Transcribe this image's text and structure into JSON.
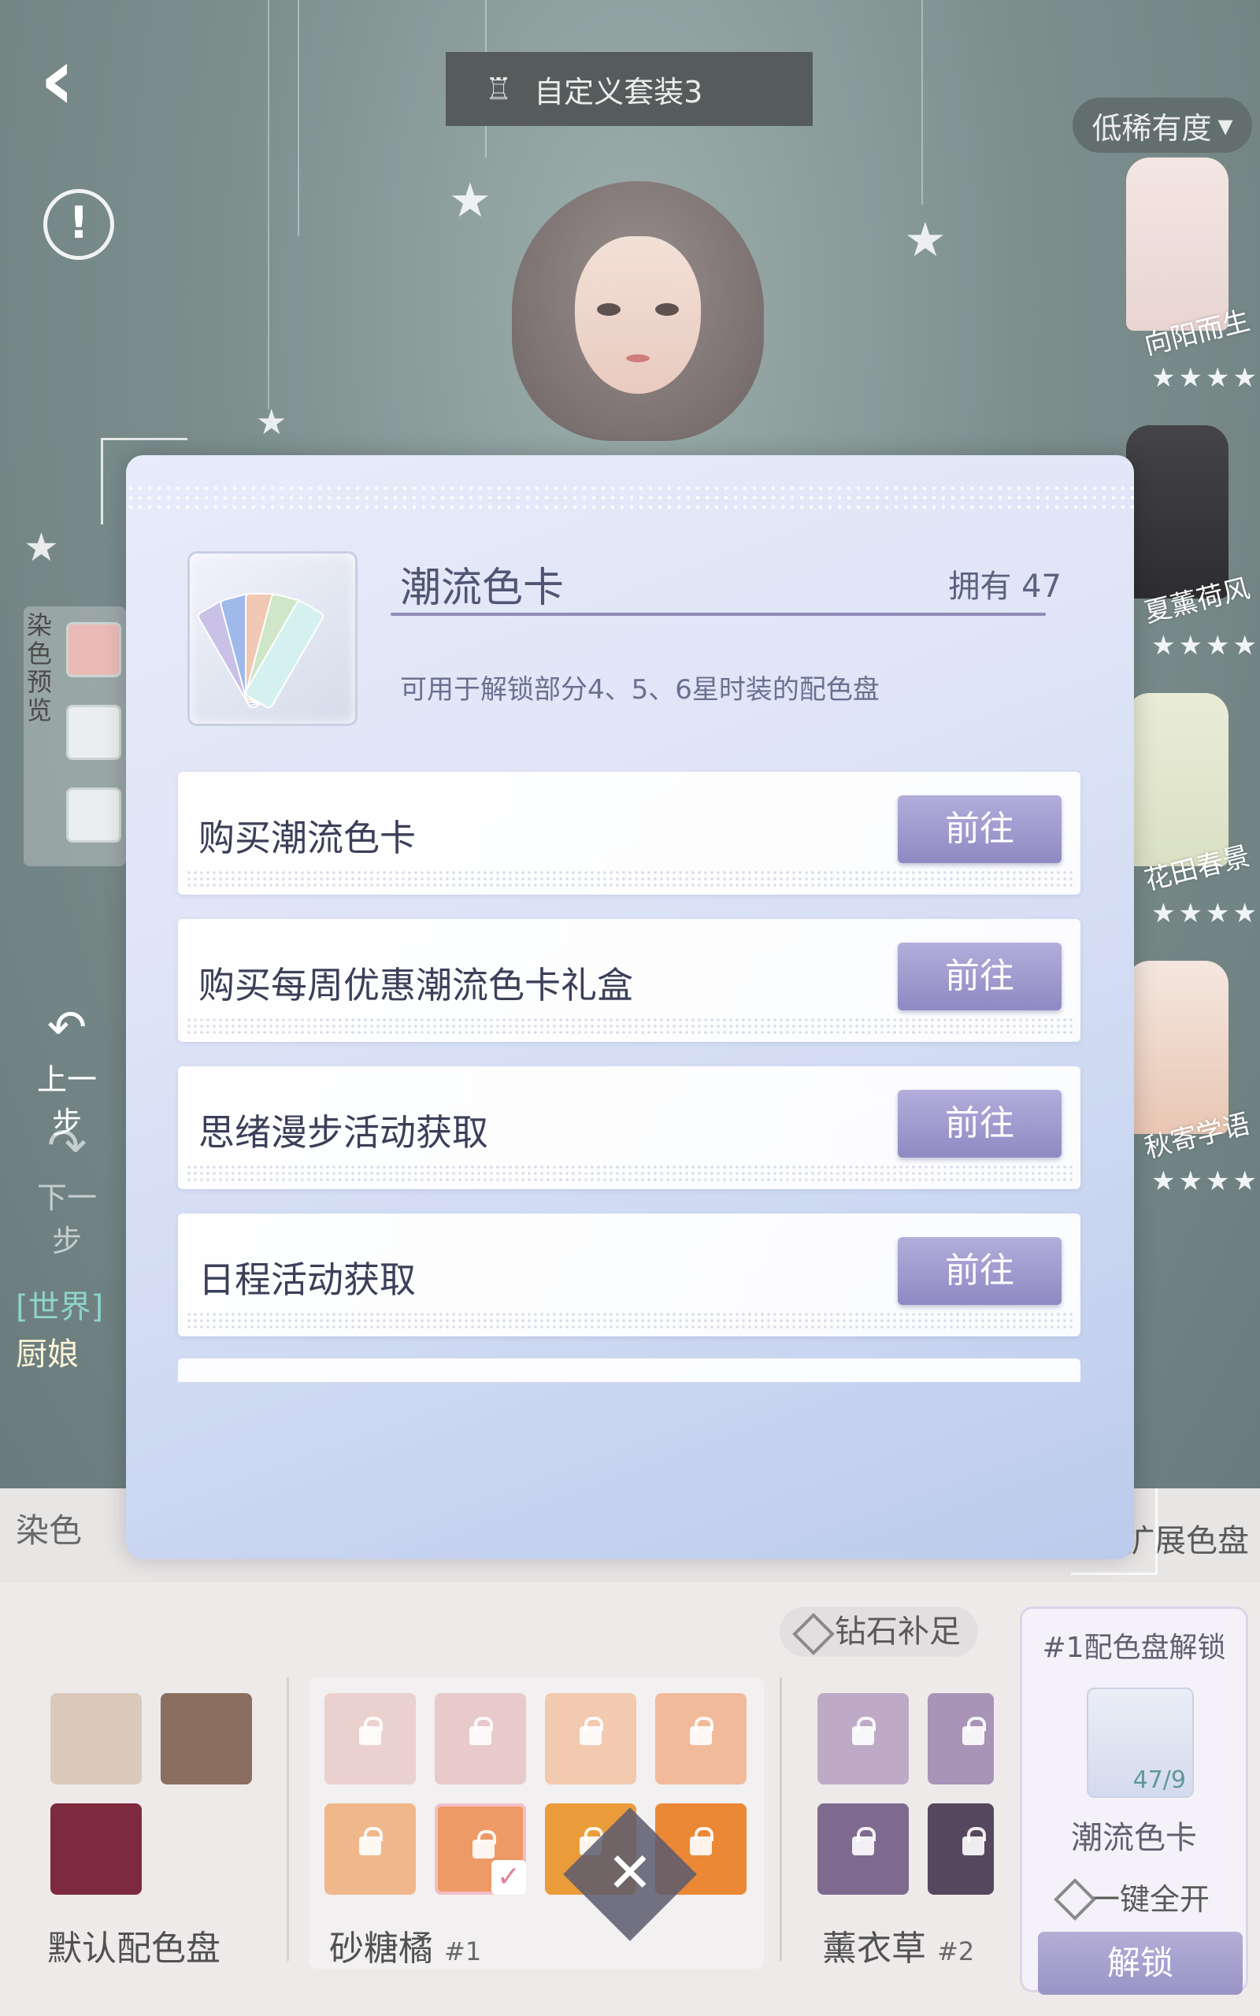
{
  "header": {
    "outfit_name": "自定义套装3",
    "sort_label": "低稀有度"
  },
  "outfits": [
    {
      "name": "向阳而生",
      "stars": "★★★★"
    },
    {
      "name": "夏薰荷风",
      "stars": "★★★★"
    },
    {
      "name": "花田春景",
      "stars": "★★★★"
    },
    {
      "name": "秋寄学语",
      "stars": "★★★★"
    }
  ],
  "left": {
    "dye_preview_label": "染色预览",
    "undo_label": "上一步",
    "redo_label": "下一步",
    "chat_channel": "[世界]",
    "chat_user": "厨娘"
  },
  "dye_tabs": {
    "left_tab": "染色",
    "right_tab": "扩展色盘"
  },
  "modal": {
    "item_name": "潮流色卡",
    "owned_label": "拥有 47",
    "description": "可用于解锁部分4、5、6星时装的配色盘",
    "rows": [
      {
        "label": "购买潮流色卡",
        "button": "前往"
      },
      {
        "label": "购买每周优惠潮流色卡礼盒",
        "button": "前往"
      },
      {
        "label": "思绪漫步活动获取",
        "button": "前往"
      },
      {
        "label": "日程活动获取",
        "button": "前往"
      }
    ]
  },
  "bottom": {
    "diamond_fill": "钻石补足",
    "groups": [
      {
        "name": "默认配色盘",
        "index": ""
      },
      {
        "name": "砂糖橘",
        "index": "#1"
      },
      {
        "name": "薰衣草",
        "index": "#2"
      }
    ],
    "unlock_panel": {
      "title": "#1配色盘解锁",
      "count": "47/9",
      "card_name": "潮流色卡",
      "all_open": "一键全开",
      "unlock_button": "解锁"
    }
  },
  "colors": {
    "modal_button": "#9e98cf",
    "accent_line": "#8f8bb8",
    "default_swatches": [
      "#d7c3b3",
      "#7a5a4a",
      "#6b0d24"
    ],
    "orange_swatches": [
      "#e9cbc8",
      "#e5c3c3",
      "#f0c3a6",
      "#f0b28e",
      "#eeae7a",
      "#ec8c52",
      "#e98f1f",
      "#e8781a"
    ],
    "lavender_swatches": [
      "#b59fc0",
      "#9d86ad",
      "#6e5680",
      "#3e2e48"
    ]
  }
}
